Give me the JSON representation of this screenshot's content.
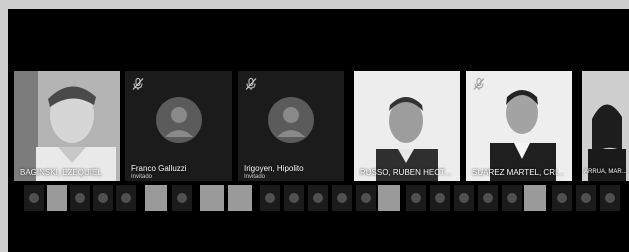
{
  "participants": [
    {
      "name": "BAGINSKI, EZEQUIEL",
      "role": "",
      "video": true,
      "muted": false
    },
    {
      "name": "Franco Galluzzi",
      "role": "Invitado",
      "video": false,
      "muted": true
    },
    {
      "name": "Irigoyen, Hipolito",
      "role": "Invitado",
      "video": false,
      "muted": true
    },
    {
      "name": "RUSSO, RUBEN HECT...",
      "role": "",
      "video": true,
      "muted": false
    },
    {
      "name": "SUAREZ MARTEL, CRI...",
      "role": "",
      "video": true,
      "muted": true
    },
    {
      "name": "ARRUA, MAR...",
      "role": "",
      "video": true,
      "muted": false
    }
  ],
  "icons": {
    "mic_off": "microphone-off-icon",
    "avatar": "person-icon"
  },
  "colors": {
    "background": "#000000",
    "tile": "#1b1b1b",
    "avatar": "#5b5b5b",
    "frame": "#cfcfcf"
  }
}
